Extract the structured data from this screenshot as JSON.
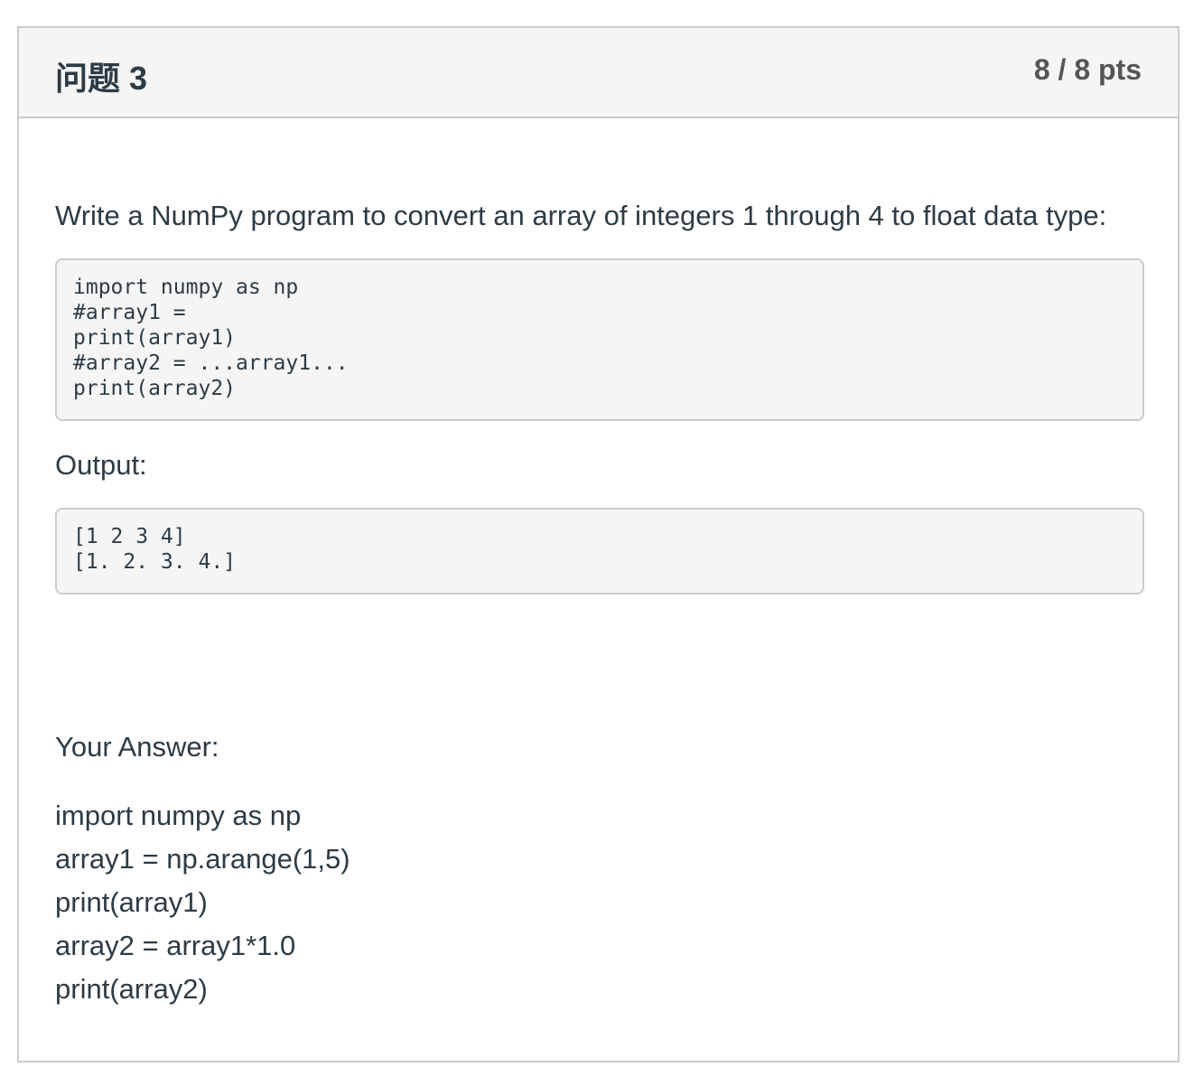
{
  "question": {
    "title": "问题 3",
    "points": "8 / 8 pts",
    "prompt": "Write a NumPy program to convert an array of integers 1 through 4 to float data type:",
    "code_lines": [
      "import numpy as np",
      "#array1 =",
      "print(array1)",
      "#array2 = ...array1...",
      "print(array2)"
    ],
    "output_label": "Output:",
    "output_lines": [
      "[1 2 3 4]",
      "[1. 2. 3. 4.]"
    ],
    "answer_label": "Your Answer:",
    "answer_lines": [
      "import numpy as np",
      "array1 = np.arange(1,5)",
      "print(array1)",
      "array2 = array1*1.0",
      "print(array2)"
    ]
  },
  "colors": {
    "header_background": "#f5f5f5",
    "border": "#c7cdd1",
    "text": "#2d3b45",
    "points_text": "#555555"
  }
}
